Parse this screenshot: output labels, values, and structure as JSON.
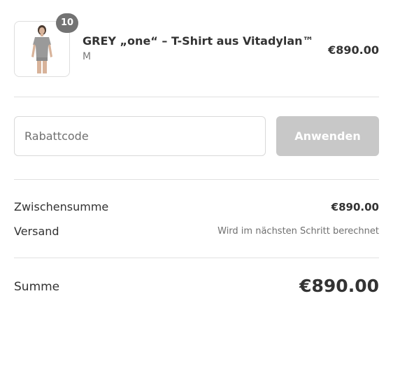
{
  "product": {
    "quantity": "10",
    "name": "GREY „one“ – T-Shirt aus Vitadylan™",
    "variant": "M",
    "price": "€890.00",
    "image_icon": "grey-tshirt-model-image"
  },
  "discount": {
    "placeholder": "Rabattcode",
    "value": "",
    "apply_label": "Anwenden"
  },
  "totals": {
    "subtotal_label": "Zwischensumme",
    "subtotal_value": "€890.00",
    "shipping_label": "Versand",
    "shipping_value": "Wird im nächsten Schritt berechnet",
    "total_label": "Summe",
    "total_value": "€890.00"
  },
  "colors": {
    "badge": "#737373",
    "button_disabled": "#c8c8c8",
    "border": "#d9d9d9",
    "divider": "#e1e1e1",
    "text": "#333333",
    "muted_text": "#707070"
  }
}
